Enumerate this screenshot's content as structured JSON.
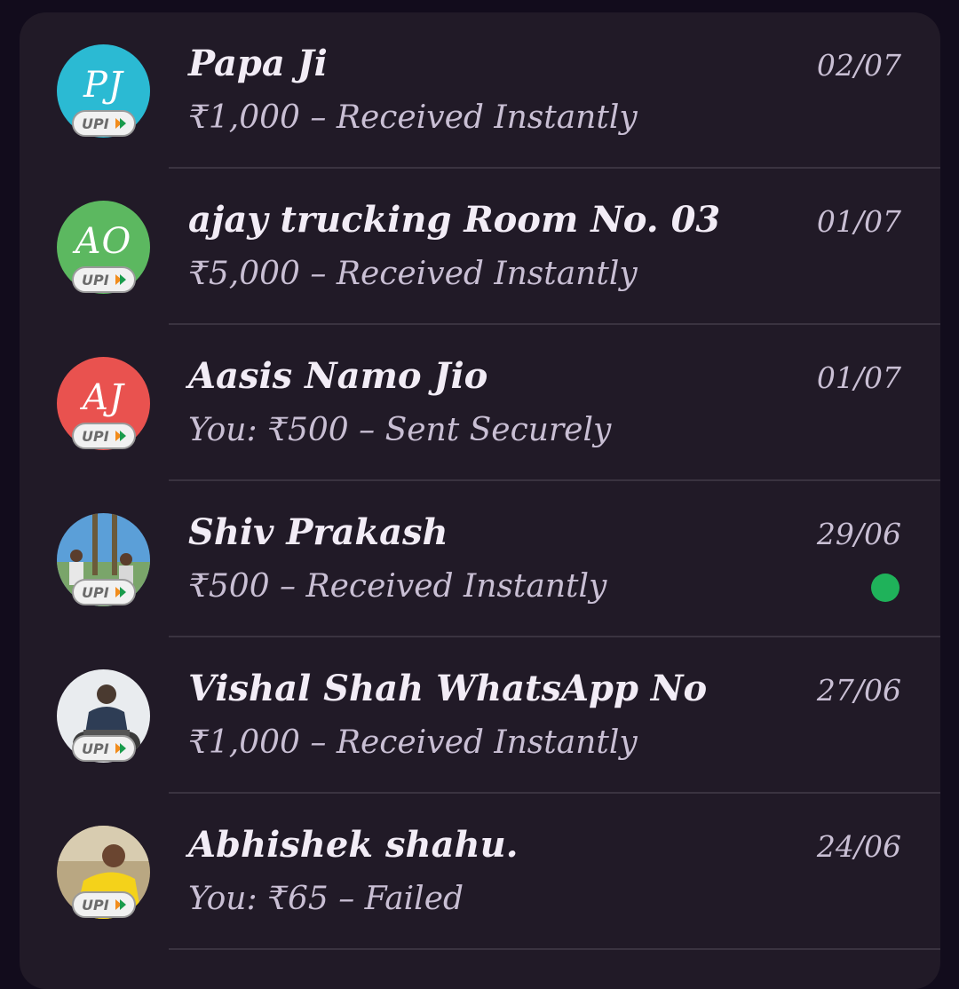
{
  "badge": {
    "label": "UPI"
  },
  "colors": {
    "background": "#120c1c",
    "card": "#211a27",
    "name_text": "#f2ecf6",
    "secondary_text": "#c9bfd4",
    "unread_dot": "#1fb25a"
  },
  "conversations": [
    {
      "initials": "PJ",
      "avatar_color": "#2bbad3",
      "name": "Papa Ji",
      "subtitle": "₹1,000 – Received Instantly",
      "date": "02/07",
      "unread": false
    },
    {
      "initials": "AO",
      "avatar_color": "#5cb860",
      "name": "ajay trucking Room No. 03",
      "subtitle": "₹5,000 – Received Instantly",
      "date": "01/07",
      "unread": false
    },
    {
      "initials": "AJ",
      "avatar_color": "#e9524f",
      "name": "Aasis Namo Jio",
      "subtitle": "You: ₹500 – Sent Securely",
      "date": "01/07",
      "unread": false
    },
    {
      "initials": "",
      "avatar_icon": "profile-photo",
      "name": "Shiv Prakash",
      "subtitle": "₹500 – Received Instantly",
      "date": "29/06",
      "unread": true
    },
    {
      "initials": "",
      "avatar_icon": "profile-photo",
      "name": "Vishal Shah WhatsApp No",
      "subtitle": "₹1,000 – Received Instantly",
      "date": "27/06",
      "unread": false
    },
    {
      "initials": "",
      "avatar_icon": "profile-photo",
      "name": "Abhishek shahu.",
      "subtitle": "You: ₹65 – Failed",
      "date": "24/06",
      "unread": false
    }
  ]
}
